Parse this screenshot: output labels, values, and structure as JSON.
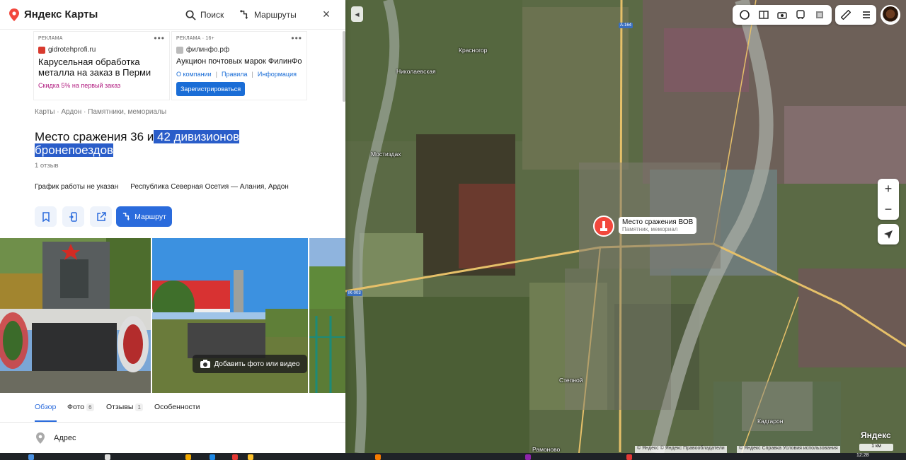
{
  "header": {
    "brand": "Яндекс Карты",
    "search_label": "Поиск",
    "routes_label": "Маршруты",
    "close_label": "×"
  },
  "ads": [
    {
      "label": "РЕКЛАМА",
      "site": "gidrotehprofi.ru",
      "title": "Карусельная обработка металла на заказ в Перми",
      "subtitle": "Скидка 5% на первый заказ"
    },
    {
      "label": "РЕКЛАМА · 16+",
      "site": "филинфо.рф",
      "title": "Аукцион почтовых марок ФилинФо",
      "links": [
        "О компании",
        "Правила",
        "Информация"
      ],
      "button": "Зарегистрироваться"
    }
  ],
  "breadcrumbs": [
    "Карты",
    "Ардон",
    "Памятники, мемориалы"
  ],
  "place": {
    "title_part1": "Место сражения 36 и",
    "title_part2": " 42 дивизионов бронепоездов",
    "reviews": "1 отзыв",
    "hours": "График работы не указан",
    "address": "Республика Северная Осетия — Алания, Ардон",
    "route_button": "Маршрут",
    "add_photo": "Добавить фото или видео"
  },
  "tabs": [
    {
      "label": "Обзор",
      "count": ""
    },
    {
      "label": "Фото",
      "count": "6"
    },
    {
      "label": "Отзывы",
      "count": "1"
    },
    {
      "label": "Особенности",
      "count": ""
    }
  ],
  "address_section": "Адрес",
  "map": {
    "marker_name": "Место сражения ВОВ",
    "marker_category": "Памятник, мемориал",
    "places": [
      "Красногор",
      "Николаевская",
      "Мостиздах",
      "Степной",
      "Рамоново",
      "Кадгарон"
    ],
    "roads": [
      "A-164",
      "IK-003"
    ],
    "copyright1": "© Яндекс © Яндекс   Правообладатели",
    "copyright2": "© Яндекс   Справка   Условия использования",
    "logo": "Яндекс",
    "scale": "1 км"
  },
  "taskbar": {
    "clock": "12:28"
  }
}
